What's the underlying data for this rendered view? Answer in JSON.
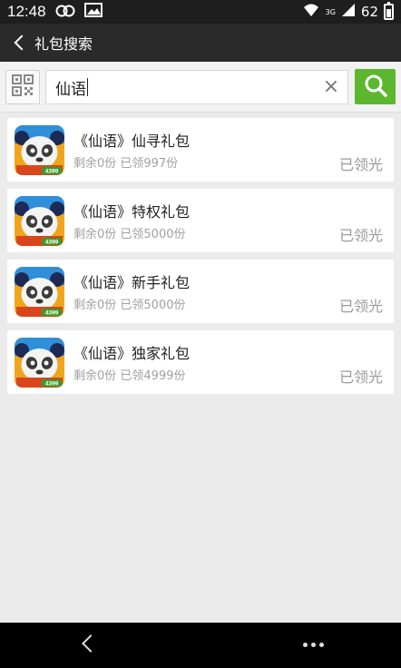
{
  "status_bar": {
    "time": "12:48",
    "network": "3G",
    "battery": "62",
    "battery_level": 0.62
  },
  "header": {
    "back_icon": "chevron-left-icon",
    "title": "礼包搜索"
  },
  "search": {
    "value": "仙语",
    "clear_icon": "×",
    "button_icon": "search-icon",
    "qr_icon": "qr-code-icon",
    "button_color": "#5cb72f"
  },
  "gifts": [
    {
      "title": "《仙语》仙寻礼包",
      "subtitle": "剩余0份  已领997份",
      "status": "已领光"
    },
    {
      "title": "《仙语》特权礼包",
      "subtitle": "剩余0份  已领5000份",
      "status": "已领光"
    },
    {
      "title": "《仙语》新手礼包",
      "subtitle": "剩余0份  已领5000份",
      "status": "已领光"
    },
    {
      "title": "《仙语》独家礼包",
      "subtitle": "剩余0份  已领4999份",
      "status": "已领光"
    }
  ],
  "app_icon_badge": "4399",
  "nav": {
    "back_icon": "back-icon",
    "more_icon": "more-icon"
  }
}
